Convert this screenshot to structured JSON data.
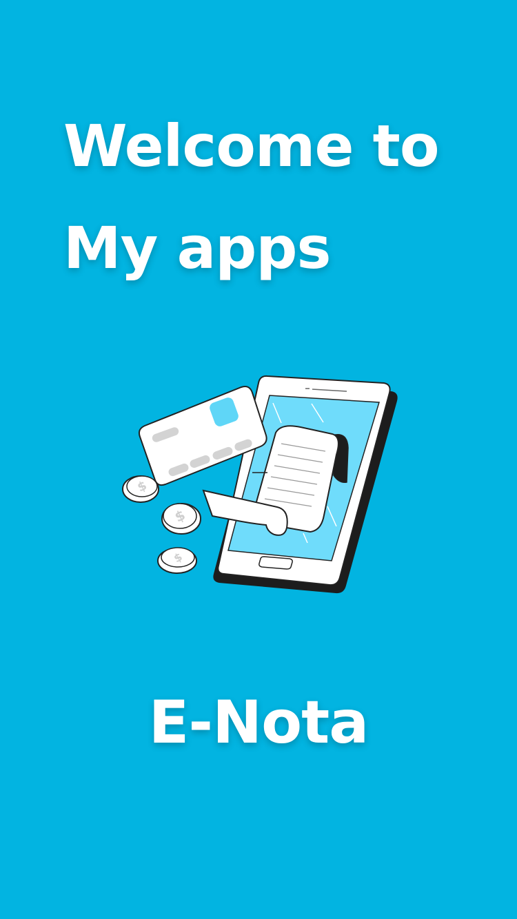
{
  "splash": {
    "welcome_line1": "Welcome to",
    "welcome_line2": "My apps",
    "app_name": "E-Nota",
    "illustration_icon": "mobile-payment-receipt-icon"
  },
  "colors": {
    "background": "#02b4e1",
    "text": "#ffffff",
    "screen": "#6fdcfb",
    "card_accent": "#5fd6f7",
    "outline": "#222222"
  }
}
